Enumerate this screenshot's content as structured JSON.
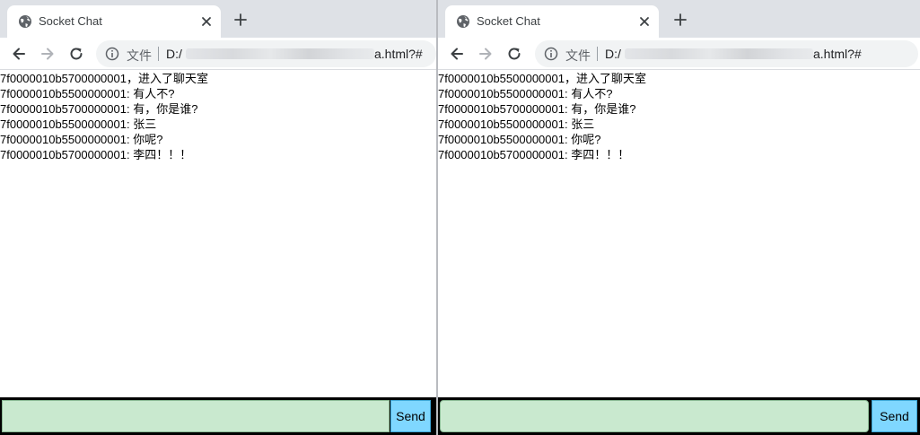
{
  "windows": [
    {
      "tab": {
        "title": "Socket Chat"
      },
      "address": {
        "scheme_label": "文件",
        "url_start": "D:/",
        "url_end": "a.html?#"
      },
      "messages": [
        "7f0000010b5700000001，进入了聊天室",
        "7f0000010b5500000001: 有人不?",
        "7f0000010b5700000001: 有，你是谁?",
        "7f0000010b5500000001: 张三",
        "7f0000010b5500000001: 你呢?",
        "7f0000010b5700000001: 李四！！！"
      ],
      "composer": {
        "input_value": "",
        "send_label": "Send"
      }
    },
    {
      "tab": {
        "title": "Socket Chat"
      },
      "address": {
        "scheme_label": "文件",
        "url_start": "D:/",
        "url_end": "a.html?#"
      },
      "messages": [
        "7f0000010b5500000001，进入了聊天室",
        "7f0000010b5500000001: 有人不?",
        "7f0000010b5700000001: 有，你是谁?",
        "7f0000010b5500000001: 张三",
        "7f0000010b5500000001: 你呢?",
        "7f0000010b5700000001: 李四！！！"
      ],
      "composer": {
        "input_value": "",
        "send_label": "Send"
      }
    }
  ],
  "icons": {
    "favicon": "globe-icon",
    "tab_close": "close-icon",
    "new_tab": "plus-icon",
    "back": "arrow-left-icon",
    "forward": "arrow-right-icon",
    "reload": "reload-icon",
    "site_info": "info-icon"
  },
  "colors": {
    "input_background": "#c9e9cf",
    "send_background": "#7fd7ff",
    "composer_border": "#000000",
    "tabstrip": "#dee1e6"
  }
}
